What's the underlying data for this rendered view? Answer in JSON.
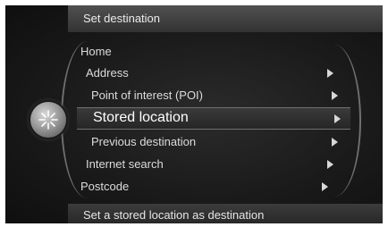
{
  "header": {
    "title": "Set destination"
  },
  "footer": {
    "hint": "Set a stored location as destination"
  },
  "knob": {
    "icon": "compass-star-icon"
  },
  "menu": {
    "items": [
      {
        "label": "Home",
        "arrow": false,
        "selected": false
      },
      {
        "label": "Address",
        "arrow": true,
        "selected": false
      },
      {
        "label": "Point of interest (POI)",
        "arrow": true,
        "selected": false
      },
      {
        "label": "Stored location",
        "arrow": true,
        "selected": true
      },
      {
        "label": "Previous destination",
        "arrow": true,
        "selected": false
      },
      {
        "label": "Internet search",
        "arrow": true,
        "selected": false
      },
      {
        "label": "Postcode",
        "arrow": true,
        "selected": false
      }
    ]
  }
}
